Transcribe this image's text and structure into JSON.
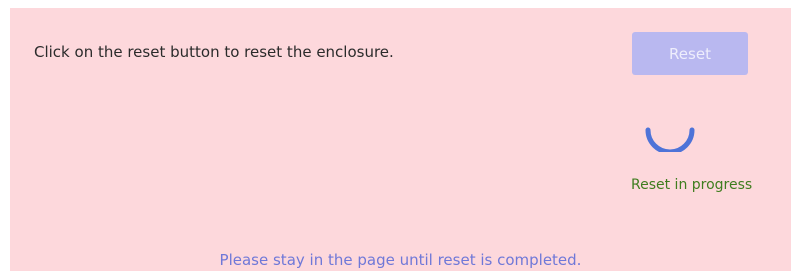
{
  "enclosure_reset": {
    "instruction": "Click on the reset button to reset the enclosure.",
    "reset_button_label": "Reset",
    "reset_button_disabled": true,
    "status_text": "Reset in progress",
    "footer_note": "Please stay in the page until reset is completed.",
    "spinner_icon": "loading-spinner-icon"
  },
  "colors": {
    "panel_background": "#fdd8dc",
    "button_background": "#b9b8f0",
    "spinner": "#4e73d8",
    "status_text": "#3f7d1f",
    "footer_text": "#6f78d8"
  }
}
